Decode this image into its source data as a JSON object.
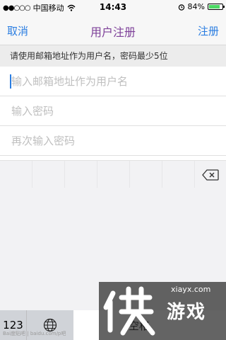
{
  "status_bar": {
    "carrier": "中国移动",
    "time": "14:43",
    "battery": "84%",
    "battery_level": 0.84,
    "icons": [
      "signal-dots-icon",
      "wifi-icon",
      "alarm-icon",
      "battery-icon"
    ]
  },
  "nav": {
    "cancel_label": "取消",
    "title": "用户注册",
    "register_label": "注册",
    "accent_color": "#2a7de1",
    "title_color": "#7d3f98"
  },
  "hint": "请使用邮箱地址作为用户名，密码最少5位",
  "form": {
    "email_placeholder": "输入邮箱地址作为用户名",
    "password_placeholder": "输入密码",
    "confirm_placeholder": "再次输入密码"
  },
  "keyboard": {
    "key_123": "123",
    "space_label": "空格",
    "icons": [
      "globe-icon",
      "delete-icon"
    ]
  },
  "watermark": {
    "site_url": "xiayx.com",
    "brand": "游戏",
    "baidu_text": "Bai度贴吧 | baidu.com/p吧"
  }
}
